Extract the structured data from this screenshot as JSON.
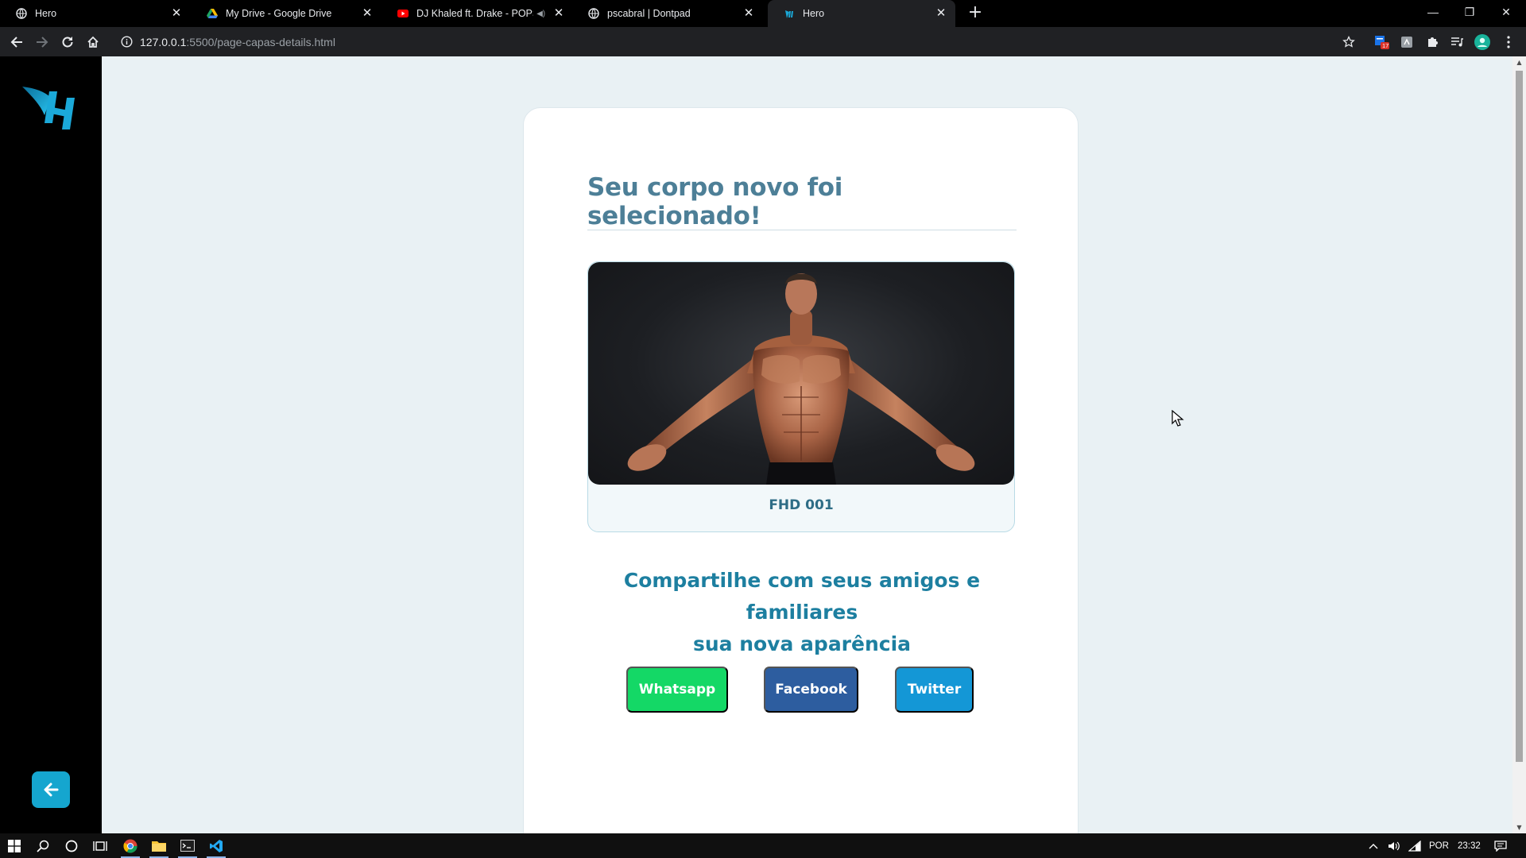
{
  "browser": {
    "tabs": [
      {
        "title": "Hero",
        "icon": "globe-icon"
      },
      {
        "title": "My Drive - Google Drive",
        "icon": "google-drive-icon"
      },
      {
        "title": "DJ Khaled ft. Drake - POPSTA",
        "icon": "youtube-icon"
      },
      {
        "title": "pscabral | Dontpad",
        "icon": "globe-icon"
      },
      {
        "title": "Hero",
        "icon": "hero-logo-icon"
      }
    ],
    "active_tab_index": 4,
    "url_host": "127.0.0.1",
    "url_path": ":5500/page-capas-details.html",
    "extension_badge": "17"
  },
  "page": {
    "title": "Seu corpo novo foi selecionado!",
    "product_code": "FHD 001",
    "share_text_line1": "Compartilhe com seus amigos e familiares",
    "share_text_line2": "sua nova aparência",
    "buttons": {
      "whatsapp": "Whatsapp",
      "facebook": "Facebook",
      "twitter": "Twitter"
    },
    "colors": {
      "accent": "#15a6cf",
      "whatsapp": "#14d866",
      "facebook": "#2d5d9f",
      "twitter": "#1497d6"
    }
  },
  "taskbar": {
    "language": "POR",
    "time": "23:32"
  }
}
